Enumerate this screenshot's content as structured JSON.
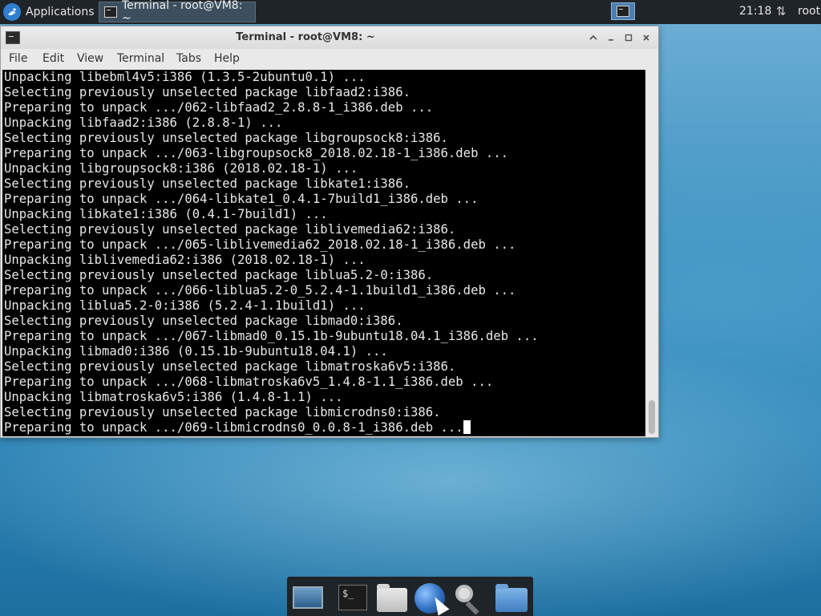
{
  "top_panel": {
    "applications_label": "Applications",
    "taskbar_item_label": "Terminal - root@VM8: ~",
    "clock": "21:18",
    "user": "root"
  },
  "terminal": {
    "title": "Terminal - root@VM8: ~",
    "menu": [
      "File",
      "Edit",
      "View",
      "Terminal",
      "Tabs",
      "Help"
    ],
    "lines": [
      "Unpacking libebml4v5:i386 (1.3.5-2ubuntu0.1) ...",
      "Selecting previously unselected package libfaad2:i386.",
      "Preparing to unpack .../062-libfaad2_2.8.8-1_i386.deb ...",
      "Unpacking libfaad2:i386 (2.8.8-1) ...",
      "Selecting previously unselected package libgroupsock8:i386.",
      "Preparing to unpack .../063-libgroupsock8_2018.02.18-1_i386.deb ...",
      "Unpacking libgroupsock8:i386 (2018.02.18-1) ...",
      "Selecting previously unselected package libkate1:i386.",
      "Preparing to unpack .../064-libkate1_0.4.1-7build1_i386.deb ...",
      "Unpacking libkate1:i386 (0.4.1-7build1) ...",
      "Selecting previously unselected package liblivemedia62:i386.",
      "Preparing to unpack .../065-liblivemedia62_2018.02.18-1_i386.deb ...",
      "Unpacking liblivemedia62:i386 (2018.02.18-1) ...",
      "Selecting previously unselected package liblua5.2-0:i386.",
      "Preparing to unpack .../066-liblua5.2-0_5.2.4-1.1build1_i386.deb ...",
      "Unpacking liblua5.2-0:i386 (5.2.4-1.1build1) ...",
      "Selecting previously unselected package libmad0:i386.",
      "Preparing to unpack .../067-libmad0_0.15.1b-9ubuntu18.04.1_i386.deb ...",
      "Unpacking libmad0:i386 (0.15.1b-9ubuntu18.04.1) ...",
      "Selecting previously unselected package libmatroska6v5:i386.",
      "Preparing to unpack .../068-libmatroska6v5_1.4.8-1.1_i386.deb ...",
      "Unpacking libmatroska6v5:i386 (1.4.8-1.1) ...",
      "Selecting previously unselected package libmicrodns0:i386.",
      "Preparing to unpack .../069-libmicrodns0_0.0.8-1_i386.deb ..."
    ]
  },
  "dock": {
    "items": [
      "desktop-icon",
      "terminal-icon",
      "home-folder-icon",
      "web-browser-icon",
      "app-finder-icon",
      "file-manager-icon"
    ],
    "terminal_glyph": "$_"
  }
}
